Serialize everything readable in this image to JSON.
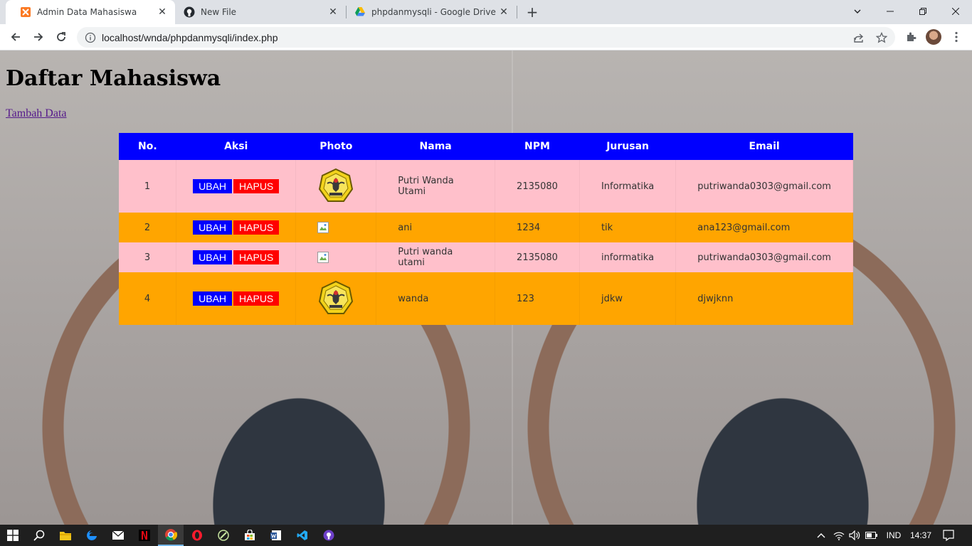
{
  "browser": {
    "tabs": [
      {
        "title": "Admin Data Mahasiswa",
        "icon": "xampp-icon"
      },
      {
        "title": "New File",
        "icon": "github-icon"
      },
      {
        "title": "phpdanmysqli - Google Drive",
        "icon": "google-drive-icon"
      }
    ],
    "url": "localhost/wnda/phpdanmysqli/index.php"
  },
  "page": {
    "title": "Daftar Mahasiswa",
    "add_link": "Tambah Data",
    "table": {
      "headers": [
        "No.",
        "Aksi",
        "Photo",
        "Nama",
        "NPM",
        "Jurusan",
        "Email"
      ],
      "edit_label": "UBAH",
      "delete_label": "HAPUS",
      "rows": [
        {
          "no": "1",
          "photo": "logo",
          "nama": "Putri Wanda Utami",
          "npm": "2135080",
          "jurusan": "Informatika",
          "email": "putriwanda0303@gmail.com"
        },
        {
          "no": "2",
          "photo": "broken",
          "nama": "ani",
          "npm": "1234",
          "jurusan": "tik",
          "email": "ana123@gmail.com"
        },
        {
          "no": "3",
          "photo": "broken",
          "nama": "Putri wanda utami",
          "npm": "2135080",
          "jurusan": "informatika",
          "email": "putriwanda0303@gmail.com"
        },
        {
          "no": "4",
          "photo": "logo",
          "nama": "wanda",
          "npm": "123",
          "jurusan": "jdkw",
          "email": "djwjknn"
        }
      ]
    },
    "colors": {
      "header": "#0000ff",
      "row_odd": "#ffc0cb",
      "row_even": "#ffa500",
      "edit": "#0000ff",
      "delete": "#ff0000"
    }
  },
  "taskbar": {
    "language": "IND",
    "time": "14:37"
  }
}
